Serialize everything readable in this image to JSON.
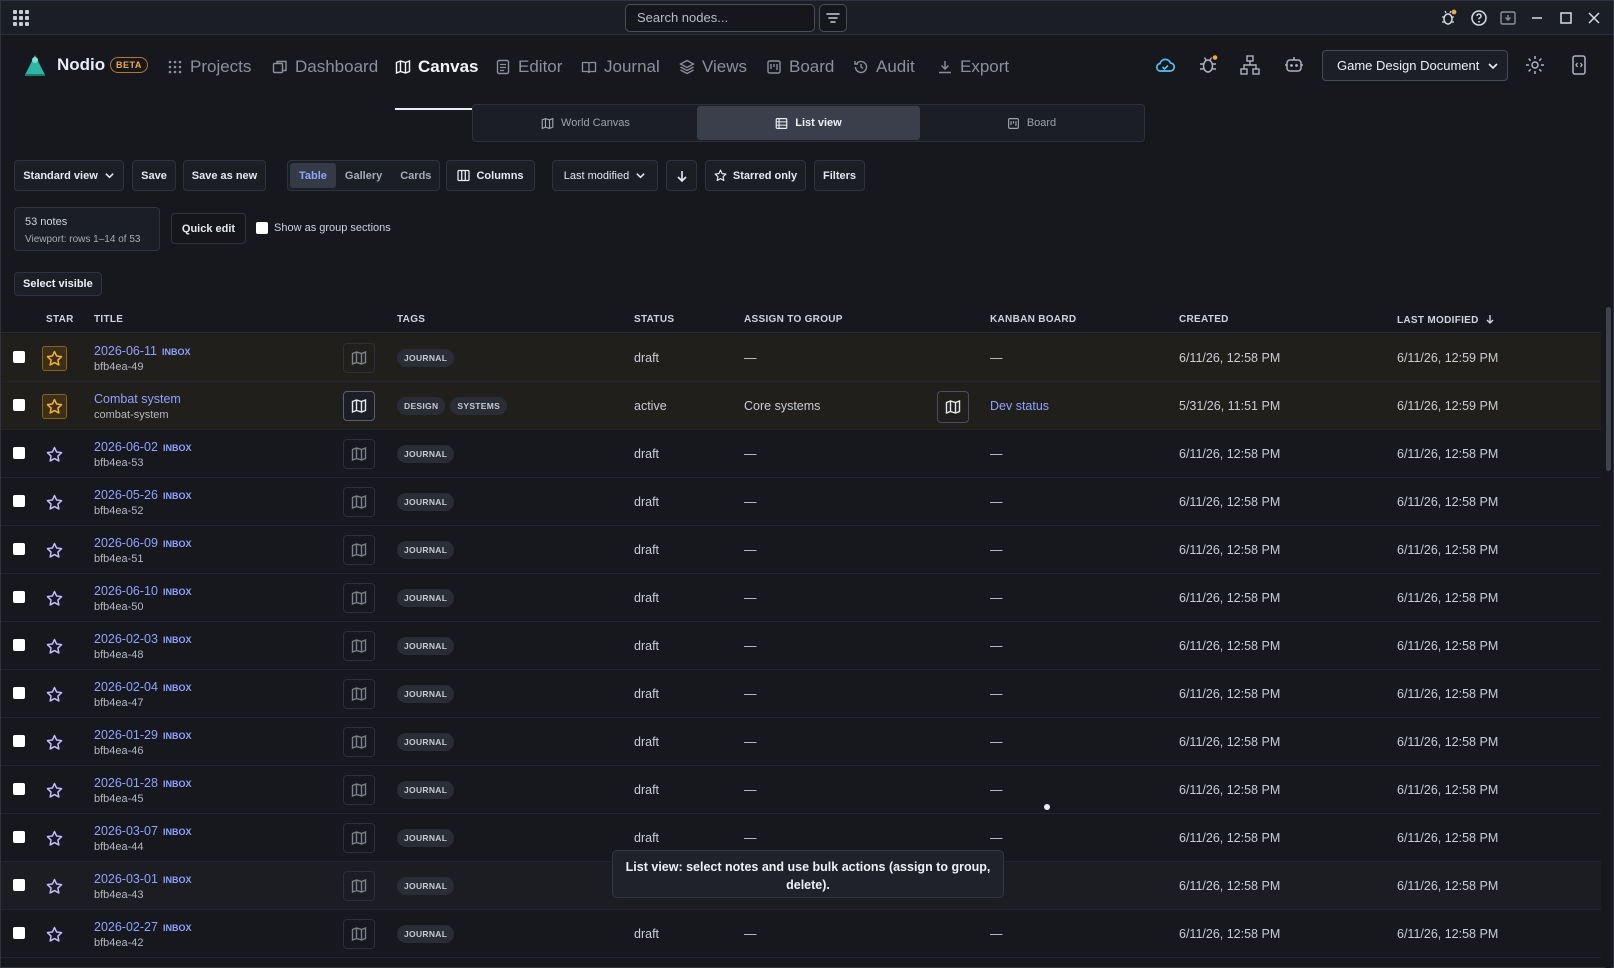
{
  "titlebar": {
    "search_placeholder": "Search nodes..."
  },
  "app": {
    "brand": "Nodio",
    "beta": "BETA"
  },
  "nav": [
    {
      "label": "Projects",
      "icon": "grid-icon",
      "active": false
    },
    {
      "label": "Dashboard",
      "icon": "copy-icon",
      "active": false
    },
    {
      "label": "Canvas",
      "icon": "map-icon",
      "active": true
    },
    {
      "label": "Editor",
      "icon": "document-icon",
      "active": false
    },
    {
      "label": "Journal",
      "icon": "book-icon",
      "active": false
    },
    {
      "label": "Views",
      "icon": "layers-icon",
      "active": false
    },
    {
      "label": "Board",
      "icon": "kanban-icon",
      "active": false
    },
    {
      "label": "Audit",
      "icon": "history-icon",
      "active": false
    },
    {
      "label": "Export",
      "icon": "download-icon",
      "active": false
    }
  ],
  "document_select": "Game Design Document",
  "view_switch": [
    {
      "label": "World Canvas",
      "active": false
    },
    {
      "label": "List view",
      "active": true
    },
    {
      "label": "Board",
      "active": false
    }
  ],
  "toolbar": {
    "view_select": "Standard view",
    "save": "Save",
    "save_as_new": "Save as new",
    "layouts": [
      "Table",
      "Gallery",
      "Cards"
    ],
    "active_layout": "Table",
    "columns": "Columns",
    "sort": "Last modified",
    "starred_only": "Starred only",
    "filters": "Filters"
  },
  "summary": {
    "count": "53 notes",
    "viewport": "Viewport: rows 1–14 of 53",
    "quick_edit": "Quick edit",
    "group_sections": "Show as group sections",
    "select_visible": "Select visible"
  },
  "columns": {
    "star": "STAR",
    "title": "TITLE",
    "tags": "TAGS",
    "status": "STATUS",
    "group": "ASSIGN TO GROUP",
    "kanban": "KANBAN BOARD",
    "created": "CREATED",
    "modified": "LAST MODIFIED"
  },
  "rows": [
    {
      "title": "2026-06-11",
      "inbox": "INBOX",
      "slug": "bfb4ea-49",
      "starred": true,
      "tags": [
        "JOURNAL"
      ],
      "status": "draft",
      "group": "—",
      "kanban": "—",
      "created": "6/11/26, 12:58 PM",
      "modified": "6/11/26, 12:59 PM"
    },
    {
      "title": "Combat system",
      "inbox": "",
      "slug": "combat-system",
      "starred": true,
      "tags": [
        "DESIGN",
        "SYSTEMS"
      ],
      "status": "active",
      "group": "Core systems",
      "kanban": "Dev status",
      "created": "5/31/26, 11:51 PM",
      "modified": "6/11/26, 12:59 PM"
    },
    {
      "title": "2026-06-02",
      "inbox": "INBOX",
      "slug": "bfb4ea-53",
      "starred": false,
      "tags": [
        "JOURNAL"
      ],
      "status": "draft",
      "group": "—",
      "kanban": "—",
      "created": "6/11/26, 12:58 PM",
      "modified": "6/11/26, 12:58 PM"
    },
    {
      "title": "2026-05-26",
      "inbox": "INBOX",
      "slug": "bfb4ea-52",
      "starred": false,
      "tags": [
        "JOURNAL"
      ],
      "status": "draft",
      "group": "—",
      "kanban": "—",
      "created": "6/11/26, 12:58 PM",
      "modified": "6/11/26, 12:58 PM"
    },
    {
      "title": "2026-06-09",
      "inbox": "INBOX",
      "slug": "bfb4ea-51",
      "starred": false,
      "tags": [
        "JOURNAL"
      ],
      "status": "draft",
      "group": "—",
      "kanban": "—",
      "created": "6/11/26, 12:58 PM",
      "modified": "6/11/26, 12:58 PM"
    },
    {
      "title": "2026-06-10",
      "inbox": "INBOX",
      "slug": "bfb4ea-50",
      "starred": false,
      "tags": [
        "JOURNAL"
      ],
      "status": "draft",
      "group": "—",
      "kanban": "—",
      "created": "6/11/26, 12:58 PM",
      "modified": "6/11/26, 12:58 PM"
    },
    {
      "title": "2026-02-03",
      "inbox": "INBOX",
      "slug": "bfb4ea-48",
      "starred": false,
      "tags": [
        "JOURNAL"
      ],
      "status": "draft",
      "group": "—",
      "kanban": "—",
      "created": "6/11/26, 12:58 PM",
      "modified": "6/11/26, 12:58 PM"
    },
    {
      "title": "2026-02-04",
      "inbox": "INBOX",
      "slug": "bfb4ea-47",
      "starred": false,
      "tags": [
        "JOURNAL"
      ],
      "status": "draft",
      "group": "—",
      "kanban": "—",
      "created": "6/11/26, 12:58 PM",
      "modified": "6/11/26, 12:58 PM"
    },
    {
      "title": "2026-01-29",
      "inbox": "INBOX",
      "slug": "bfb4ea-46",
      "starred": false,
      "tags": [
        "JOURNAL"
      ],
      "status": "draft",
      "group": "—",
      "kanban": "—",
      "created": "6/11/26, 12:58 PM",
      "modified": "6/11/26, 12:58 PM"
    },
    {
      "title": "2026-01-28",
      "inbox": "INBOX",
      "slug": "bfb4ea-45",
      "starred": false,
      "tags": [
        "JOURNAL"
      ],
      "status": "draft",
      "group": "—",
      "kanban": "—",
      "created": "6/11/26, 12:58 PM",
      "modified": "6/11/26, 12:58 PM"
    },
    {
      "title": "2026-03-07",
      "inbox": "INBOX",
      "slug": "bfb4ea-44",
      "starred": false,
      "tags": [
        "JOURNAL"
      ],
      "status": "draft",
      "group": "—",
      "kanban": "—",
      "created": "6/11/26, 12:58 PM",
      "modified": "6/11/26, 12:58 PM"
    },
    {
      "title": "2026-03-01",
      "inbox": "INBOX",
      "slug": "bfb4ea-43",
      "starred": false,
      "tags": [
        "JOURNAL"
      ],
      "status": "",
      "group": "",
      "kanban": "",
      "created": "6/11/26, 12:58 PM",
      "modified": "6/11/26, 12:58 PM"
    },
    {
      "title": "2026-02-27",
      "inbox": "INBOX",
      "slug": "bfb4ea-42",
      "starred": false,
      "tags": [
        "JOURNAL"
      ],
      "status": "draft",
      "group": "—",
      "kanban": "—",
      "created": "6/11/26, 12:58 PM",
      "modified": "6/11/26, 12:58 PM"
    }
  ],
  "tooltip": "List view: select notes and use bulk actions (assign to group, delete).",
  "colors": {
    "accent": "#8fa2ff",
    "star_active": "#f2b233",
    "background": "#16181d"
  }
}
